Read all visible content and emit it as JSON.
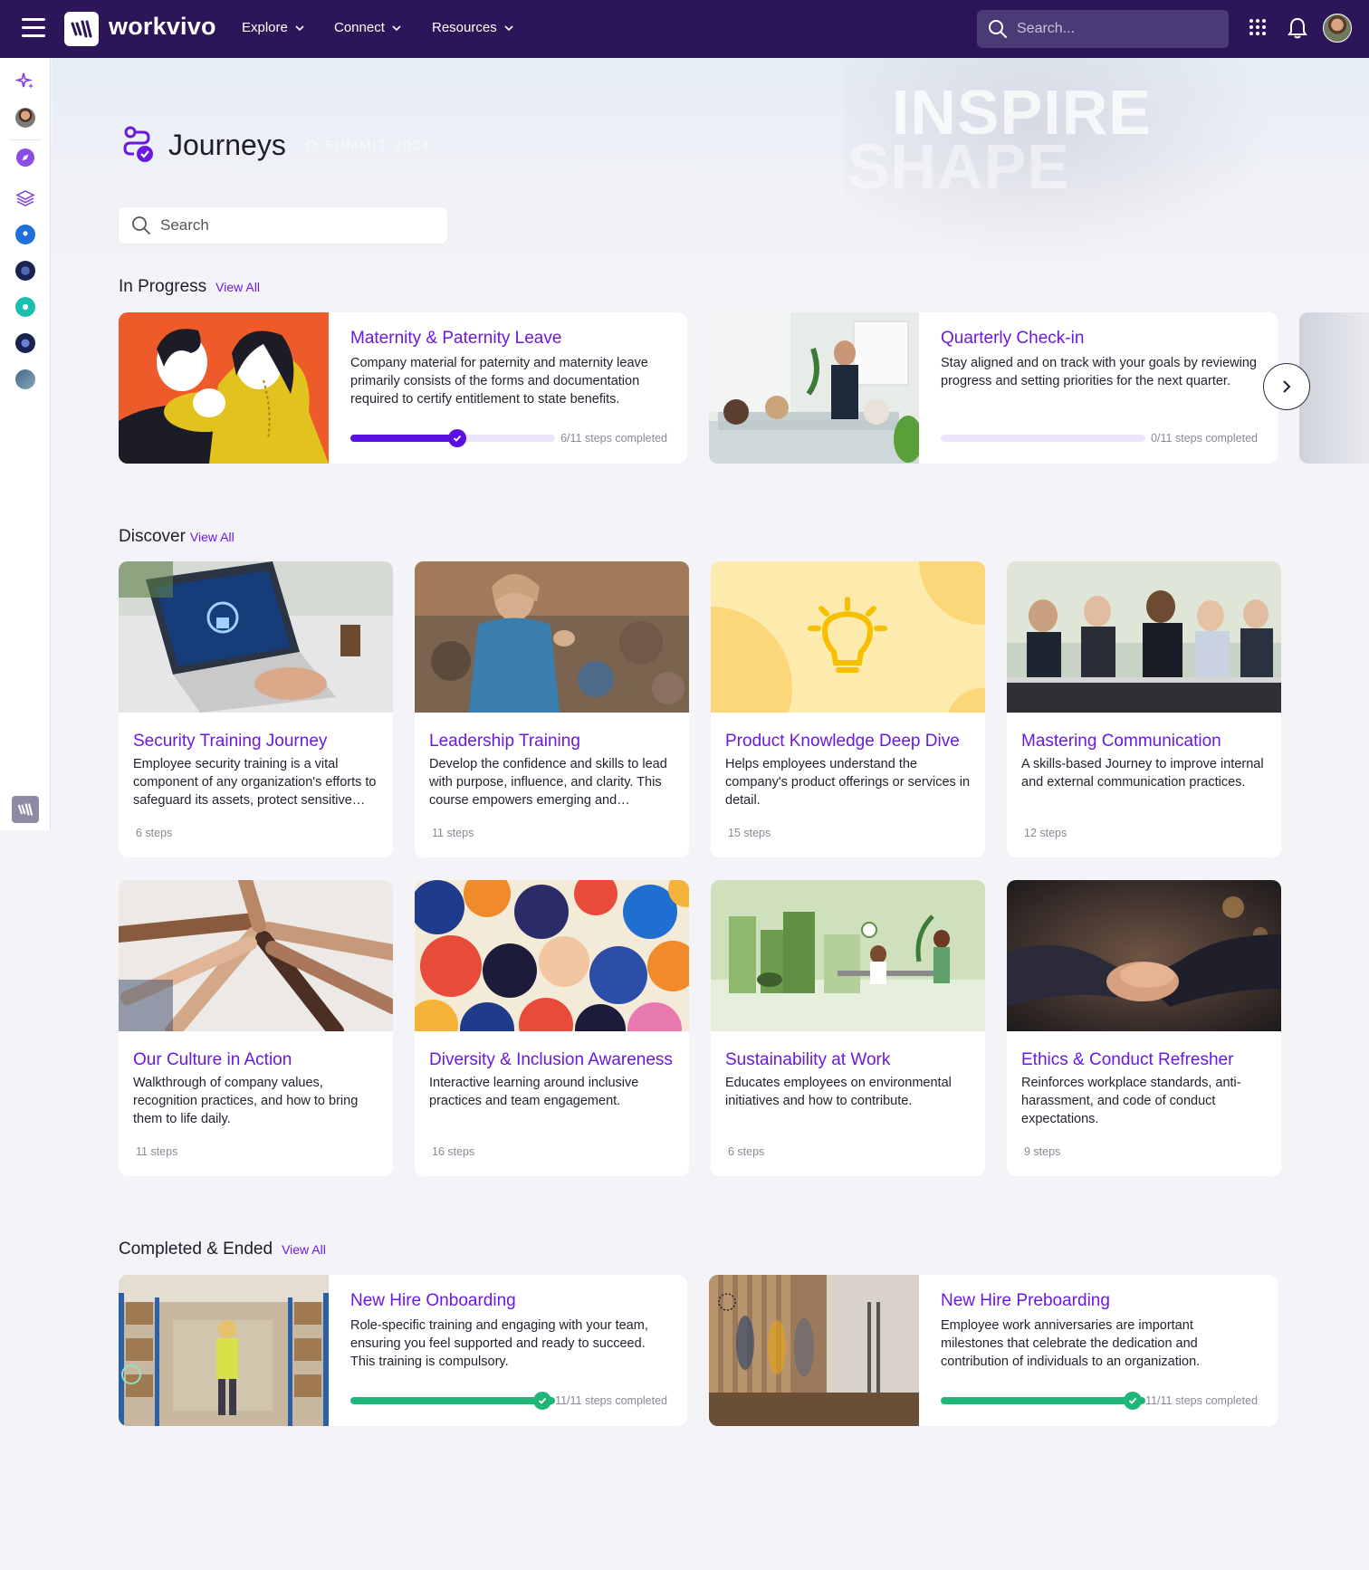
{
  "header": {
    "brand": "workvivo",
    "nav": [
      {
        "label": "Explore"
      },
      {
        "label": "Connect"
      },
      {
        "label": "Resources"
      }
    ],
    "search_placeholder": "Search..."
  },
  "hero": {
    "words": [
      "INSPIRE",
      "SHAPE"
    ],
    "faded_text": "O SUMMIT 2024"
  },
  "page": {
    "title": "Journeys",
    "search_placeholder": "Search"
  },
  "colors": {
    "topbar": "#2c1659",
    "accent": "#6b18e0",
    "progress_active": "#5b0fe0",
    "progress_complete": "#1fb67a"
  },
  "in_progress": {
    "title": "In Progress",
    "view_all": "View All",
    "cards": [
      {
        "title": "Maternity & Paternity Leave",
        "description": "Company material for paternity and maternity leave primarily consists of the forms and documentation required to certify entitlement to state benefits.",
        "progress_text": "6/11 steps completed",
        "progress_fraction": 0.545
      },
      {
        "title": "Quarterly Check-in",
        "description": "Stay aligned and on track with your goals by reviewing progress and setting priorities for the next quarter.",
        "progress_text": "0/11 steps completed",
        "progress_fraction": 0
      }
    ]
  },
  "discover": {
    "title": "Discover",
    "view_all": "View All",
    "cards": [
      {
        "title": "Security Training Journey",
        "description": "Employee security training is a vital component of any organization's efforts to safeguard its assets, protect sensitive information and people.",
        "steps": "6 steps"
      },
      {
        "title": "Leadership Training",
        "description": "Develop the confidence and skills to lead with purpose, influence, and clarity. This course empowers emerging and established leaders.",
        "steps": "11 steps"
      },
      {
        "title": "Product Knowledge Deep Dive",
        "description": "Helps employees understand the company's product offerings or services in detail.",
        "steps": "15 steps"
      },
      {
        "title": "Mastering Communication",
        "description": "A skills-based Journey to improve internal and external communication practices.",
        "steps": "12 steps"
      },
      {
        "title": "Our Culture in Action",
        "description": "Walkthrough of company values, recognition practices, and how to bring them to life daily.",
        "steps": "11 steps"
      },
      {
        "title": "Diversity & Inclusion Awareness",
        "description": "Interactive learning around inclusive practices and team engagement.",
        "steps": "16 steps"
      },
      {
        "title": "Sustainability at Work",
        "description": "Educates employees on environmental initiatives and how to contribute.",
        "steps": "6 steps"
      },
      {
        "title": "Ethics & Conduct Refresher",
        "description": "Reinforces workplace standards, anti-harassment, and code of conduct expectations.",
        "steps": "9 steps"
      }
    ]
  },
  "completed": {
    "title": "Completed & Ended",
    "view_all": "View All",
    "cards": [
      {
        "title": "New Hire Onboarding",
        "description": "Role-specific training and engaging with your team, ensuring you feel supported and ready to succeed. This training is compulsory.",
        "progress_text": "11/11 steps completed",
        "progress_fraction": 1
      },
      {
        "title": "New Hire Preboarding",
        "description": "Employee work anniversaries are important milestones that celebrate the dedication and contribution of individuals to an organization.",
        "progress_text": "11/11 steps completed",
        "progress_fraction": 1
      }
    ]
  }
}
